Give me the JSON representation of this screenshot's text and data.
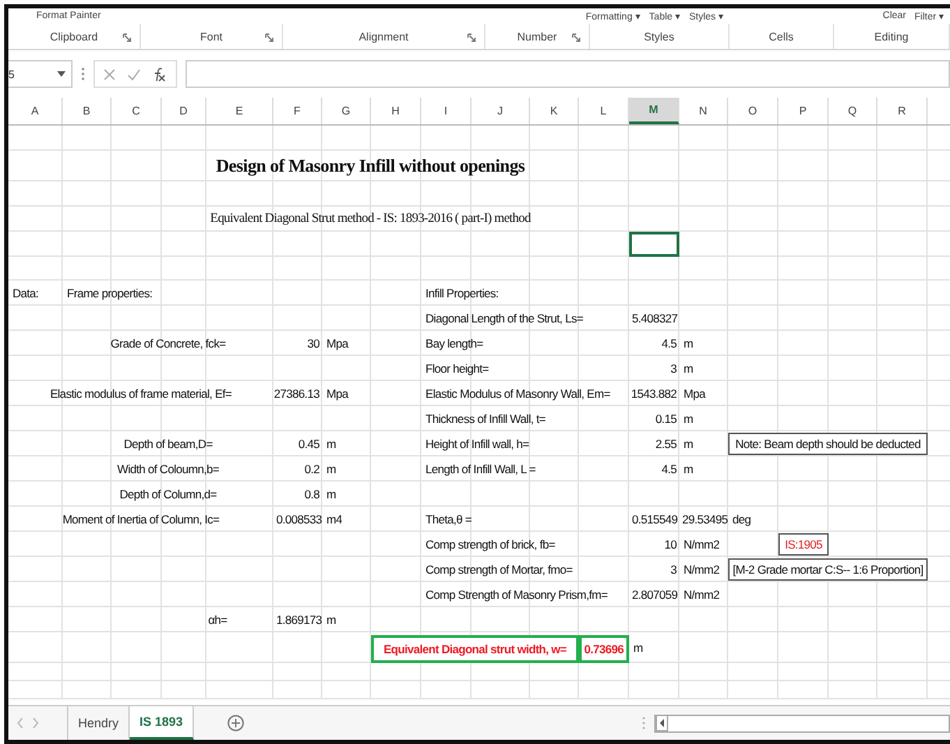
{
  "ribbon": {
    "groups": [
      {
        "label": "Clipboard",
        "launcher": true,
        "top_items": [
          "Format Painter"
        ]
      },
      {
        "label": "Font",
        "launcher": true
      },
      {
        "label": "Alignment",
        "launcher": true
      },
      {
        "label": "Number",
        "launcher": true
      },
      {
        "label": "Styles",
        "top_items": [
          "Formatting ▾",
          "Table ▾",
          "Styles ▾"
        ]
      },
      {
        "label": "Cells"
      },
      {
        "label": "Editing",
        "top_items": [
          "Clear",
          "Filter ▾"
        ]
      }
    ]
  },
  "formula_bar": {
    "name_box": "5"
  },
  "columns": [
    {
      "label": "A",
      "selected": false
    },
    {
      "label": "B",
      "selected": false
    },
    {
      "label": "C",
      "selected": false
    },
    {
      "label": "D",
      "selected": false
    },
    {
      "label": "E",
      "selected": false
    },
    {
      "label": "F",
      "selected": false
    },
    {
      "label": "G",
      "selected": false
    },
    {
      "label": "H",
      "selected": false
    },
    {
      "label": "I",
      "selected": false
    },
    {
      "label": "J",
      "selected": false
    },
    {
      "label": "K",
      "selected": false
    },
    {
      "label": "L",
      "selected": false
    },
    {
      "label": "M",
      "selected": true
    },
    {
      "label": "N",
      "selected": false
    },
    {
      "label": "O",
      "selected": false
    },
    {
      "label": "P",
      "selected": false
    },
    {
      "label": "Q",
      "selected": false
    },
    {
      "label": "R",
      "selected": false
    }
  ],
  "cells": [
    {
      "kind": "title",
      "text": "Design of Masonry Infill without openings"
    },
    {
      "kind": "subtitle",
      "text": "Equivalent Diagonal Strut method -  IS: 1893-2016 ( part-I) method"
    },
    {
      "kind": "selection",
      "selected": true
    },
    {
      "kind": "label",
      "text": "Data:"
    },
    {
      "kind": "label",
      "text": "Frame properties:"
    },
    {
      "kind": "label",
      "text": "Infill Properties:"
    },
    {
      "kind": "label",
      "text": "Diagonal Length of the Strut, Ls="
    },
    {
      "kind": "text_value",
      "text": "5.408327"
    },
    {
      "kind": "centered",
      "text": "Grade of Concrete, fck="
    },
    {
      "kind": "number",
      "text": "30"
    },
    {
      "kind": "unit",
      "text": "Mpa"
    },
    {
      "kind": "label",
      "text": "Bay length="
    },
    {
      "kind": "number",
      "text": "4.5"
    },
    {
      "kind": "unit",
      "text": "m"
    },
    {
      "kind": "label",
      "text": "Floor height="
    },
    {
      "kind": "number",
      "text": "3"
    },
    {
      "kind": "unit",
      "text": "m"
    },
    {
      "kind": "centered",
      "text": "Elastic modulus of frame material, Ef="
    },
    {
      "kind": "number",
      "text": "27386.13"
    },
    {
      "kind": "unit",
      "text": "Mpa"
    },
    {
      "kind": "label",
      "text": "Elastic Modulus of Masonry Wall, Em="
    },
    {
      "kind": "number",
      "text": "1543.882"
    },
    {
      "kind": "unit",
      "text": "Mpa"
    },
    {
      "kind": "label",
      "text": "Thickness of Infill Wall, t="
    },
    {
      "kind": "number",
      "text": "0.15"
    },
    {
      "kind": "unit",
      "text": "m"
    },
    {
      "kind": "centered",
      "text": "Depth of beam,D="
    },
    {
      "kind": "number",
      "text": "0.45"
    },
    {
      "kind": "unit",
      "text": "m"
    },
    {
      "kind": "label",
      "text": "Height of Infill wall, h="
    },
    {
      "kind": "number",
      "text": "2.55"
    },
    {
      "kind": "unit",
      "text": "m"
    },
    {
      "kind": "note",
      "text": "Note: Beam  depth should be deducted"
    },
    {
      "kind": "centered",
      "text": "Width of Coloumn,b="
    },
    {
      "kind": "number",
      "text": "0.2"
    },
    {
      "kind": "unit",
      "text": "m"
    },
    {
      "kind": "label",
      "text": "Length of Infill Wall, L ="
    },
    {
      "kind": "number",
      "text": "4.5"
    },
    {
      "kind": "unit",
      "text": "m"
    },
    {
      "kind": "centered",
      "text": "Depth of Column,d="
    },
    {
      "kind": "number",
      "text": "0.8"
    },
    {
      "kind": "unit",
      "text": "m"
    },
    {
      "kind": "centered",
      "text": "Moment of Inertia of Column, Ic="
    },
    {
      "kind": "text_value",
      "text": "0.008533"
    },
    {
      "kind": "unit",
      "text": "m4"
    },
    {
      "kind": "label",
      "text": "Theta,θ ="
    },
    {
      "kind": "text_value",
      "text": "0.515549"
    },
    {
      "kind": "text_value",
      "text": "29.53495"
    },
    {
      "kind": "unit",
      "text": "deg"
    },
    {
      "kind": "label",
      "text": "Comp strength of brick, fb="
    },
    {
      "kind": "number",
      "text": "10"
    },
    {
      "kind": "unit",
      "text": "N/mm2"
    },
    {
      "kind": "note_red",
      "text": "IS:1905"
    },
    {
      "kind": "label",
      "text": "Comp strength of Mortar, fmo="
    },
    {
      "kind": "number",
      "text": "3"
    },
    {
      "kind": "unit",
      "text": "N/mm2"
    },
    {
      "kind": "note",
      "text": "[M-2 Grade mortar C:S-- 1:6 Proportion]"
    },
    {
      "kind": "label",
      "text": "Comp Strength of Masonry Prism,fm="
    },
    {
      "kind": "text_value",
      "text": "2.807059"
    },
    {
      "kind": "unit",
      "text": "N/mm2"
    },
    {
      "kind": "centered",
      "text": "αh="
    },
    {
      "kind": "text_value",
      "text": "1.869173"
    },
    {
      "kind": "unit",
      "text": "m"
    },
    {
      "kind": "result_label",
      "text": "Equivalent Diagonal strut width, w="
    },
    {
      "kind": "result_value",
      "text": "0.73696"
    },
    {
      "kind": "unit",
      "text": "m"
    }
  ],
  "sheet_tabs": [
    {
      "label": "Hendry",
      "selected": false
    },
    {
      "label": "IS 1893",
      "selected": true
    }
  ]
}
